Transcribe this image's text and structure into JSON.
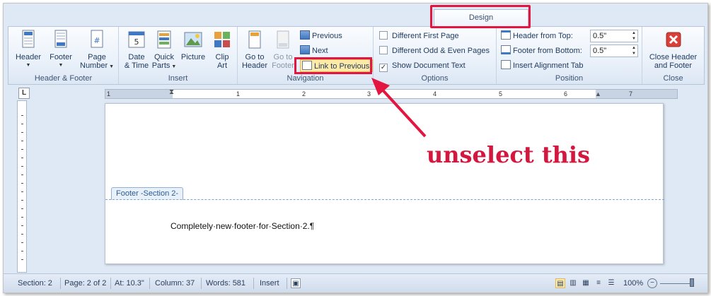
{
  "ribbon": {
    "design_tab": "Design",
    "groups": {
      "header_footer": {
        "label": "Header & Footer",
        "header": "Header",
        "footer": "Footer",
        "page_number_line1": "Page",
        "page_number_line2": "Number"
      },
      "insert": {
        "label": "Insert",
        "date_line1": "Date",
        "date_line2": "& Time",
        "quick_line1": "Quick",
        "quick_line2": "Parts",
        "picture": "Picture",
        "clip_line1": "Clip",
        "clip_line2": "Art"
      },
      "navigation": {
        "label": "Navigation",
        "goto_header_line1": "Go to",
        "goto_header_line2": "Header",
        "goto_footer_line1": "Go to",
        "goto_footer_line2": "Footer",
        "previous": "Previous",
        "next": "Next",
        "link_to_previous": "Link to Previous"
      },
      "options": {
        "label": "Options",
        "different_first_page": "Different First Page",
        "different_odd_even": "Different Odd & Even Pages",
        "show_document_text": "Show Document Text"
      },
      "position": {
        "label": "Position",
        "header_from_top": "Header from Top:",
        "header_from_top_value": "0.5\"",
        "footer_from_bottom": "Footer from Bottom:",
        "footer_from_bottom_value": "0.5\"",
        "insert_alignment_tab": "Insert Alignment Tab"
      },
      "close": {
        "label": "Close",
        "close_line1": "Close Header",
        "close_line2": "and Footer"
      }
    }
  },
  "ruler": {
    "tab_selector": "L",
    "numbers": [
      "1",
      "1",
      "2",
      "3",
      "4",
      "5",
      "6",
      "7"
    ]
  },
  "document": {
    "footer_tag": "Footer -Section 2-",
    "footer_text": "Completely·new·footer·for·Section·2.¶"
  },
  "annotation": {
    "text": "unselect this",
    "color": "#d4173f"
  },
  "status_bar": {
    "section": "Section: 2",
    "page": "Page: 2 of 2",
    "at": "At: 10.3\"",
    "column": "Column: 37",
    "words": "Words: 581",
    "mode": "Insert",
    "zoom": "100%"
  },
  "colors": {
    "accent": "#e2163f",
    "ribbon_text": "#1e395b"
  }
}
